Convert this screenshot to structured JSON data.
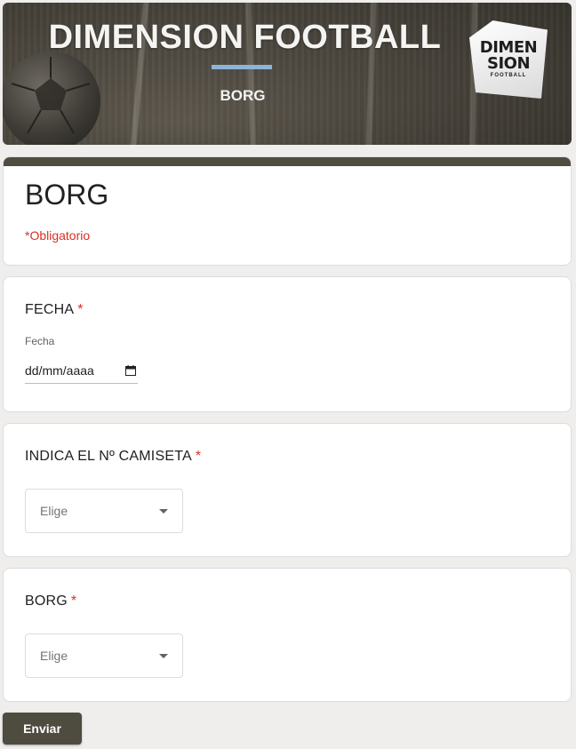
{
  "banner": {
    "title": "DIMENSION FOOTBALL",
    "subtitle": "BORG",
    "logo": {
      "line1": "DIMEN",
      "line2": "SION",
      "line3": "FOOTBALL"
    },
    "rule_color": "#8cb4d8"
  },
  "form": {
    "title": "BORG",
    "required_note": "*Obligatorio",
    "accent_color": "#4f4c40",
    "required_color": "#d93025"
  },
  "questions": {
    "fecha": {
      "title": "FECHA",
      "required_mark": "*",
      "field_label": "Fecha",
      "placeholder": "dd/mm/aaaa"
    },
    "camiseta": {
      "title": "INDICA EL Nº CAMISETA",
      "required_mark": "*",
      "select_value": "Elige"
    },
    "borg": {
      "title": "BORG",
      "required_mark": "*",
      "select_value": "Elige"
    }
  },
  "submit": {
    "label": "Enviar"
  }
}
